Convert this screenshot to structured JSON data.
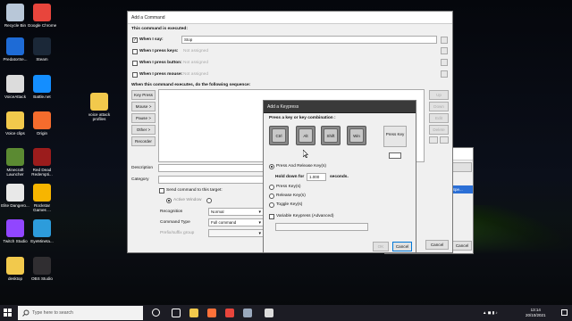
{
  "desktop": {
    "icons": [
      {
        "label": "Recycle Bin",
        "icon": "recycle-bin-icon",
        "color": "#b8c7d8"
      },
      {
        "label": "Google Chrome",
        "icon": "chrome-icon",
        "color": "#e8453c"
      },
      {
        "label": "PredatorSe...",
        "icon": "predator-sense-icon",
        "color": "#1e6bd6"
      },
      {
        "label": "Steam",
        "icon": "steam-icon",
        "color": "#1b2838"
      },
      {
        "label": "VoiceAttack",
        "icon": "voiceattack-icon",
        "color": "#dcdcdc"
      },
      {
        "label": "Battle.net",
        "icon": "battlenet-icon",
        "color": "#148eff"
      },
      {
        "label": "Voice clips",
        "icon": "folder-icon",
        "color": "#f2c94c"
      },
      {
        "label": "Origin",
        "icon": "origin-icon",
        "color": "#f56c2d"
      },
      {
        "label": "Minecraft Launcher",
        "icon": "minecraft-icon",
        "color": "#5b8a32"
      },
      {
        "label": "Red Dead Redempti...",
        "icon": "red-dead-icon",
        "color": "#9b1c1c"
      },
      {
        "label": "Elite Dangero...",
        "icon": "elite-dangerous-icon",
        "color": "#e8e8e8"
      },
      {
        "label": "Rockstar Games ...",
        "icon": "rockstar-icon",
        "color": "#f7b500"
      },
      {
        "label": "Twitch Studio",
        "icon": "twitch-icon",
        "color": "#9146ff"
      },
      {
        "label": "EyeMineta...",
        "icon": "eyemine-icon",
        "color": "#2d9cdb"
      },
      {
        "label": "desktop",
        "icon": "folder-icon",
        "color": "#f2c94c"
      },
      {
        "label": "OBS Studio",
        "icon": "obs-icon",
        "color": "#302e31"
      }
    ],
    "folder_label": "voice attack profiles"
  },
  "add_command": {
    "title": "Add a Command",
    "executed_label": "This command is executed:",
    "when_say_label": "When I say:",
    "when_say_value": "Stop",
    "when_press_keys_label": "When I press keys:",
    "when_press_keys_value": "Not assigned",
    "when_press_button_label": "When I press button:",
    "when_press_button_value": "Not assigned",
    "when_press_mouse_label": "When I press mouse:",
    "when_press_mouse_value": "Not assigned",
    "sequence_label": "When this command executes, do the following sequence:",
    "left_buttons": [
      "Key Press",
      "Mouse >",
      "Pause >",
      "Other >",
      "Recorder"
    ],
    "right_buttons": [
      "Up",
      "Down",
      "Edit",
      "Delete"
    ],
    "description_label": "Description",
    "category_label": "Category",
    "send_target_label": "Send command to this target:",
    "active_window_label": "Active Window",
    "recognition_label": "Recognition",
    "recognition_value": "Normal",
    "command_type_label": "Command Type",
    "command_type_value": "Full command",
    "prefix_group_label": "Prefix/suffix group",
    "cancel_label": "Cancel"
  },
  "behind_window": {
    "running_label": "running",
    "advanced_label": "Advanced",
    "cancel_label": "Cancel",
    "list_item": "Spe..."
  },
  "keypress": {
    "title": "Add a Keypress",
    "combo_label": "Press a key or key combination :",
    "keys": [
      "Ctrl",
      "Alt",
      "Shift",
      "Win"
    ],
    "press_key_label": "Press Key",
    "press_release_label": "Press And Release Key(s)",
    "hold_down_label": "Hold down for",
    "hold_value": "1.000",
    "seconds_label": "seconds.",
    "press_keys_label": "Press Key(s)",
    "release_keys_label": "Release Key(s)",
    "toggle_keys_label": "Toggle Key(s)",
    "variable_label": "Variable Keypress (Advanced)",
    "ok_label": "OK",
    "cancel_label": "Cancel"
  },
  "taskbar": {
    "search_placeholder": "Type here to search",
    "time": "13:14",
    "date": "20/10/2021",
    "pinned": [
      {
        "icon": "task-view-icon",
        "color": "#ffffff"
      },
      {
        "icon": "file-explorer-icon",
        "color": "#f2c94c"
      },
      {
        "icon": "firefox-icon",
        "color": "#ff7139"
      },
      {
        "icon": "chrome-taskbar-icon",
        "color": "#e8453c"
      },
      {
        "icon": "steam-taskbar-icon",
        "color": "#9aa9bd"
      },
      {
        "icon": "voiceattack-taskbar-icon",
        "color": "#dcdcdc"
      }
    ]
  }
}
